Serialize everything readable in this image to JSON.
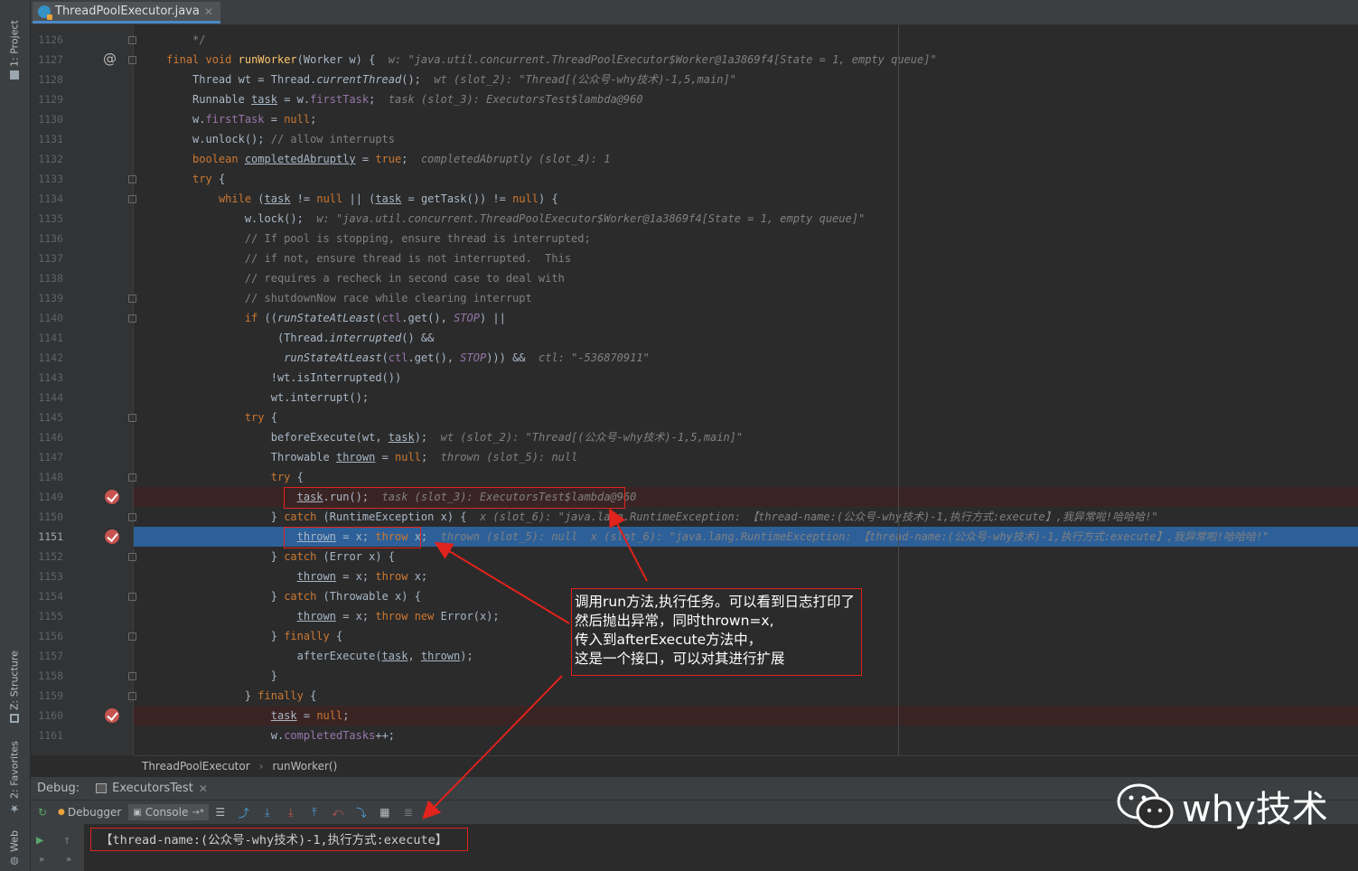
{
  "file_tab": {
    "label": "ThreadPoolExecutor.java"
  },
  "left_tools": {
    "project": "1: Project",
    "structure": "Z: Structure",
    "favorites": "2: Favorites",
    "web": "Web"
  },
  "lines": [
    {
      "num": "1126",
      "parts": [
        [
          "        ",
          ""
        ],
        [
          "*/",
          "c"
        ]
      ]
    },
    {
      "num": "1127",
      "parts": [
        [
          "    ",
          ""
        ],
        [
          "final void ",
          "k"
        ],
        [
          "runWorker",
          "f"
        ],
        [
          "(Worker w) {  ",
          ""
        ],
        [
          "w: \"java.util.concurrent.ThreadPoolExecutor$Worker@1a3869f4[State = 1, empty queue]\"",
          "h"
        ]
      ]
    },
    {
      "num": "1128",
      "parts": [
        [
          "        Thread wt = Thread.",
          ""
        ],
        [
          "currentThread",
          "it"
        ],
        [
          "();  ",
          ""
        ],
        [
          "wt (slot_2): \"Thread[(公众号-why技术)-1,5,main]\"",
          "h"
        ]
      ]
    },
    {
      "num": "1129",
      "parts": [
        [
          "        Runnable ",
          ""
        ],
        [
          "task",
          "u"
        ],
        [
          " = w.",
          ""
        ],
        [
          "firstTask",
          "fld"
        ],
        [
          ";  ",
          ""
        ],
        [
          "task (slot_3): ExecutorsTest$lambda@960",
          "h"
        ]
      ]
    },
    {
      "num": "1130",
      "parts": [
        [
          "        w.",
          ""
        ],
        [
          "firstTask",
          "fld"
        ],
        [
          " = ",
          ""
        ],
        [
          "null",
          "k"
        ],
        [
          ";",
          ""
        ]
      ]
    },
    {
      "num": "1131",
      "parts": [
        [
          "        w.unlock(); ",
          ""
        ],
        [
          "// allow interrupts",
          "c"
        ]
      ]
    },
    {
      "num": "1132",
      "parts": [
        [
          "        ",
          ""
        ],
        [
          "boolean ",
          "k"
        ],
        [
          "completedAbruptly",
          "u"
        ],
        [
          " = ",
          ""
        ],
        [
          "true",
          "k"
        ],
        [
          ";  ",
          ""
        ],
        [
          "completedAbruptly (slot_4): 1",
          "h"
        ]
      ]
    },
    {
      "num": "1133",
      "parts": [
        [
          "        ",
          ""
        ],
        [
          "try ",
          "k"
        ],
        [
          "{",
          ""
        ]
      ]
    },
    {
      "num": "1134",
      "parts": [
        [
          "            ",
          ""
        ],
        [
          "while ",
          "k"
        ],
        [
          "(",
          ""
        ],
        [
          "task",
          "u"
        ],
        [
          " != ",
          ""
        ],
        [
          "null ",
          "k"
        ],
        [
          "|| (",
          ""
        ],
        [
          "task",
          "u"
        ],
        [
          " = getTask()) != ",
          ""
        ],
        [
          "null",
          "k"
        ],
        [
          ") {",
          ""
        ]
      ]
    },
    {
      "num": "1135",
      "parts": [
        [
          "                w.lock();  ",
          ""
        ],
        [
          "w: \"java.util.concurrent.ThreadPoolExecutor$Worker@1a3869f4[State = 1, empty queue]\"",
          "h"
        ]
      ]
    },
    {
      "num": "1136",
      "parts": [
        [
          "                ",
          ""
        ],
        [
          "// If pool is stopping, ensure thread is interrupted;",
          "c"
        ]
      ]
    },
    {
      "num": "1137",
      "parts": [
        [
          "                ",
          ""
        ],
        [
          "// if not, ensure thread is not interrupted.  This",
          "c"
        ]
      ]
    },
    {
      "num": "1138",
      "parts": [
        [
          "                ",
          ""
        ],
        [
          "// requires a recheck in second case to deal with",
          "c"
        ]
      ]
    },
    {
      "num": "1139",
      "parts": [
        [
          "                ",
          ""
        ],
        [
          "// shutdownNow race while clearing interrupt",
          "c"
        ]
      ]
    },
    {
      "num": "1140",
      "parts": [
        [
          "                ",
          ""
        ],
        [
          "if ",
          "k"
        ],
        [
          "((",
          ""
        ],
        [
          "runStateAtLeast",
          "it"
        ],
        [
          "(",
          ""
        ],
        [
          "ctl",
          "fld"
        ],
        [
          ".get(), ",
          ""
        ],
        [
          "STOP",
          "fi"
        ],
        [
          ") ||",
          ""
        ]
      ]
    },
    {
      "num": "1141",
      "parts": [
        [
          "                     (Thread.",
          ""
        ],
        [
          "interrupted",
          "it"
        ],
        [
          "() &&",
          ""
        ]
      ]
    },
    {
      "num": "1142",
      "parts": [
        [
          "                      ",
          ""
        ],
        [
          "runStateAtLeast",
          "it"
        ],
        [
          "(",
          ""
        ],
        [
          "ctl",
          "fld"
        ],
        [
          ".get(), ",
          ""
        ],
        [
          "STOP",
          "fi"
        ],
        [
          "))) &&  ",
          ""
        ],
        [
          "ctl: \"-536870911\"",
          "h"
        ]
      ]
    },
    {
      "num": "1143",
      "parts": [
        [
          "                    !wt.isInterrupted())",
          ""
        ]
      ]
    },
    {
      "num": "1144",
      "parts": [
        [
          "                    wt.interrupt();",
          ""
        ]
      ]
    },
    {
      "num": "1145",
      "parts": [
        [
          "                ",
          ""
        ],
        [
          "try ",
          "k"
        ],
        [
          "{",
          ""
        ]
      ]
    },
    {
      "num": "1146",
      "parts": [
        [
          "                    beforeExecute(wt, ",
          ""
        ],
        [
          "task",
          "u"
        ],
        [
          ");  ",
          ""
        ],
        [
          "wt (slot_2): \"Thread[(公众号-why技术)-1,5,main]\"",
          "h"
        ]
      ]
    },
    {
      "num": "1147",
      "parts": [
        [
          "                    Throwable ",
          ""
        ],
        [
          "thrown",
          "u"
        ],
        [
          " = ",
          ""
        ],
        [
          "null",
          "k"
        ],
        [
          ";  ",
          ""
        ],
        [
          "thrown (slot_5): null",
          "h"
        ]
      ]
    },
    {
      "num": "1148",
      "parts": [
        [
          "                    ",
          ""
        ],
        [
          "try ",
          "k"
        ],
        [
          "{",
          ""
        ]
      ]
    },
    {
      "num": "1149",
      "parts": [
        [
          "                        ",
          ""
        ],
        [
          "task",
          "u"
        ],
        [
          ".run();  ",
          ""
        ],
        [
          "task (slot_3): ExecutorsTest$lambda@960",
          "h"
        ]
      ]
    },
    {
      "num": "1150",
      "parts": [
        [
          "                    } ",
          ""
        ],
        [
          "catch ",
          "k"
        ],
        [
          "(RuntimeException x) {  ",
          ""
        ],
        [
          "x (slot_6): \"java.lang.RuntimeException: 【thread-name:(公众号-why技术)-1,执行方式:execute】,我异常啦!哈哈哈!\"",
          "h"
        ]
      ]
    },
    {
      "num": "1151",
      "parts": [
        [
          "                        ",
          ""
        ],
        [
          "thrown",
          "u"
        ],
        [
          " = x; ",
          ""
        ],
        [
          "throw ",
          "k"
        ],
        [
          "x;  ",
          ""
        ],
        [
          "thrown (slot_5): null  x (slot_6): \"java.lang.RuntimeException: 【thread-name:(公众号-why技术)-1,执行方式:execute】,我异常啦!哈哈哈!\"",
          "h"
        ]
      ]
    },
    {
      "num": "1152",
      "parts": [
        [
          "                    } ",
          ""
        ],
        [
          "catch ",
          "k"
        ],
        [
          "(Error x) {",
          ""
        ]
      ]
    },
    {
      "num": "1153",
      "parts": [
        [
          "                        ",
          ""
        ],
        [
          "thrown",
          "u"
        ],
        [
          " = x; ",
          ""
        ],
        [
          "throw ",
          "k"
        ],
        [
          "x;",
          ""
        ]
      ]
    },
    {
      "num": "1154",
      "parts": [
        [
          "                    } ",
          ""
        ],
        [
          "catch ",
          "k"
        ],
        [
          "(Throwable x) {",
          ""
        ]
      ]
    },
    {
      "num": "1155",
      "parts": [
        [
          "                        ",
          ""
        ],
        [
          "thrown",
          "u"
        ],
        [
          " = x; ",
          ""
        ],
        [
          "throw new ",
          "k"
        ],
        [
          "Error(x);",
          ""
        ]
      ]
    },
    {
      "num": "1156",
      "parts": [
        [
          "                    } ",
          ""
        ],
        [
          "finally ",
          "k"
        ],
        [
          "{",
          ""
        ]
      ]
    },
    {
      "num": "1157",
      "parts": [
        [
          "                        afterExecute(",
          ""
        ],
        [
          "task",
          "u"
        ],
        [
          ", ",
          ""
        ],
        [
          "thrown",
          "u"
        ],
        [
          ");",
          ""
        ]
      ]
    },
    {
      "num": "1158",
      "parts": [
        [
          "                    }",
          ""
        ]
      ]
    },
    {
      "num": "1159",
      "parts": [
        [
          "                } ",
          ""
        ],
        [
          "finally ",
          "k"
        ],
        [
          "{",
          ""
        ]
      ]
    },
    {
      "num": "1160",
      "parts": [
        [
          "                    ",
          ""
        ],
        [
          "task",
          "u"
        ],
        [
          " = ",
          ""
        ],
        [
          "null",
          "k"
        ],
        [
          ";",
          ""
        ]
      ]
    },
    {
      "num": "1161",
      "parts": [
        [
          "                    w.",
          ""
        ],
        [
          "completedTasks",
          "fld"
        ],
        [
          "++;",
          ""
        ]
      ]
    }
  ],
  "breadcrumbs": {
    "class_name": "ThreadPoolExecutor",
    "method_name": "runWorker()"
  },
  "debug": {
    "label": "Debug:",
    "session": "ExecutorsTest"
  },
  "toolbar": {
    "debugger": "Debugger",
    "console": "Console"
  },
  "console": {
    "output": "【thread-name:(公众号-why技术)-1,执行方式:execute】"
  },
  "callout": {
    "line1": "调用run方法,执行任务。可以看到日志打印了",
    "line2": "然后抛出异常，同时thrown=x,",
    "line3": "传入到afterExecute方法中，",
    "line4": "这是一个接口，可以对其进行扩展"
  },
  "watermark": {
    "text": "why技术"
  },
  "colors": {
    "keyword": "#cc7832",
    "method": "#ffc66d",
    "field": "#9876aa",
    "comment": "#808080",
    "exec_line": "#2d6099",
    "breakpoint": "#c75450",
    "annotation": "#e0231c"
  }
}
